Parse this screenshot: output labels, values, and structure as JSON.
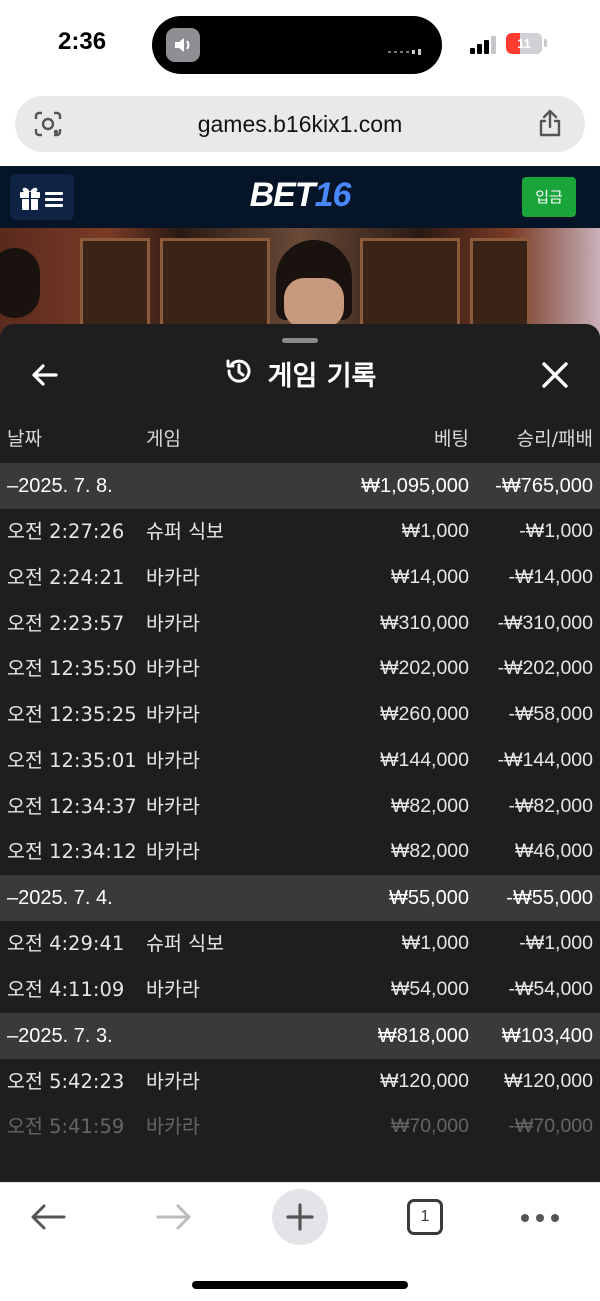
{
  "status_bar": {
    "time": "2:36",
    "battery": "11"
  },
  "browser": {
    "url": "games.b16kix1.com",
    "open_tabs": "1"
  },
  "site": {
    "logo_part1": "BET",
    "logo_part2": "16",
    "deposit_label": "입금",
    "brand_color": "#4a88ff",
    "deposit_color": "#1aa53a"
  },
  "history": {
    "title": "게임 기록",
    "columns": {
      "date": "날짜",
      "game": "게임",
      "bet": "베팅",
      "result": "승리/패배"
    },
    "rows": [
      {
        "type": "date",
        "time": "–2025. 7. 8.",
        "game": "",
        "bet": "₩1,095,000",
        "result": "-₩765,000"
      },
      {
        "type": "item",
        "time": "오전 2:27:26",
        "game": "슈퍼 식보",
        "bet": "₩1,000",
        "result": "-₩1,000"
      },
      {
        "type": "item",
        "time": "오전 2:24:21",
        "game": "바카라",
        "bet": "₩14,000",
        "result": "-₩14,000"
      },
      {
        "type": "item",
        "time": "오전 2:23:57",
        "game": "바카라",
        "bet": "₩310,000",
        "result": "-₩310,000"
      },
      {
        "type": "item",
        "time": "오전 12:35:50",
        "game": "바카라",
        "bet": "₩202,000",
        "result": "-₩202,000"
      },
      {
        "type": "item",
        "time": "오전 12:35:25",
        "game": "바카라",
        "bet": "₩260,000",
        "result": "-₩58,000"
      },
      {
        "type": "item",
        "time": "오전 12:35:01",
        "game": "바카라",
        "bet": "₩144,000",
        "result": "-₩144,000"
      },
      {
        "type": "item",
        "time": "오전 12:34:37",
        "game": "바카라",
        "bet": "₩82,000",
        "result": "-₩82,000"
      },
      {
        "type": "item",
        "time": "오전 12:34:12",
        "game": "바카라",
        "bet": "₩82,000",
        "result": "₩46,000"
      },
      {
        "type": "date",
        "time": "–2025. 7. 4.",
        "game": "",
        "bet": "₩55,000",
        "result": "-₩55,000"
      },
      {
        "type": "item",
        "time": "오전 4:29:41",
        "game": "슈퍼 식보",
        "bet": "₩1,000",
        "result": "-₩1,000"
      },
      {
        "type": "item",
        "time": "오전 4:11:09",
        "game": "바카라",
        "bet": "₩54,000",
        "result": "-₩54,000"
      },
      {
        "type": "date",
        "time": "–2025. 7. 3.",
        "game": "",
        "bet": "₩818,000",
        "result": "₩103,400"
      },
      {
        "type": "item",
        "time": "오전 5:42:23",
        "game": "바카라",
        "bet": "₩120,000",
        "result": "₩120,000"
      },
      {
        "type": "item",
        "time": "오전 5:41:59",
        "game": "바카라",
        "bet": "₩70,000",
        "result": "-₩70,000",
        "faded": true
      }
    ]
  }
}
